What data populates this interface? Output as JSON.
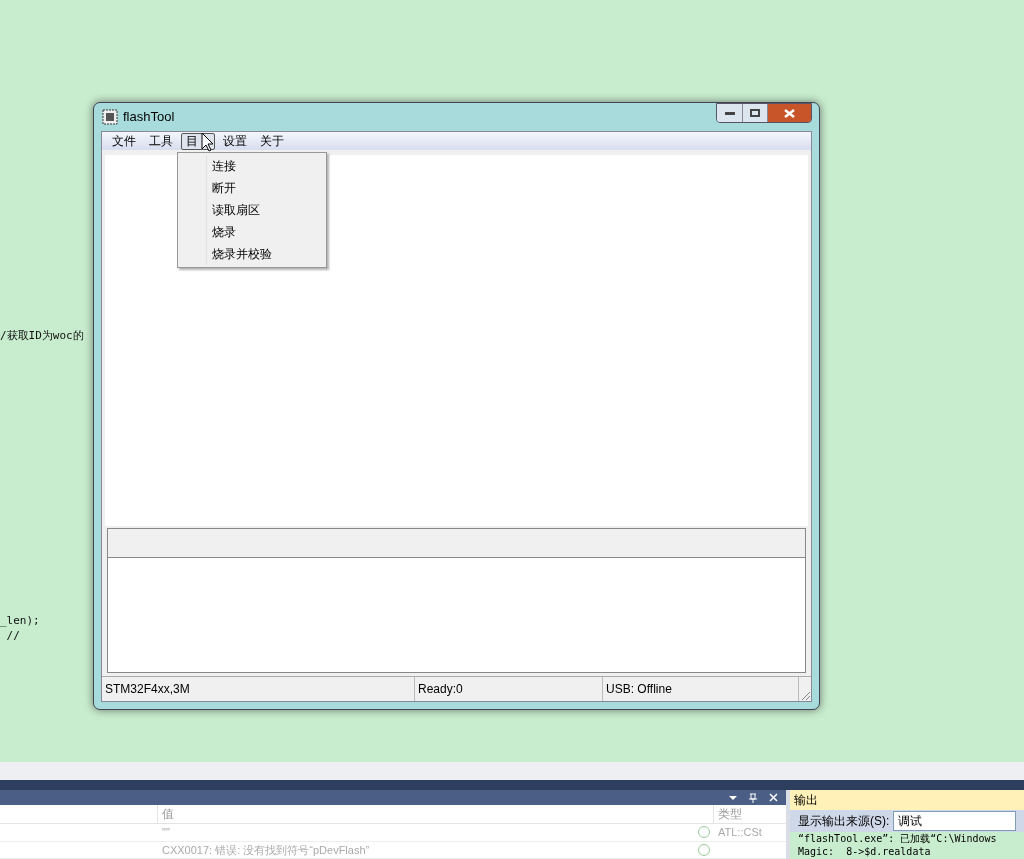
{
  "editor": {
    "code_lines": [
      "/获取ID为woc的",
      "_len);",
      " //"
    ]
  },
  "window": {
    "title": "flashTool",
    "menu": [
      {
        "label": "文件",
        "selected": false
      },
      {
        "label": "工具",
        "selected": false
      },
      {
        "label": "目",
        "selected": true
      },
      {
        "label": "设置",
        "selected": false
      },
      {
        "label": "关于",
        "selected": false
      }
    ],
    "dropdown": [
      "连接",
      "断开",
      "读取扇区",
      "烧录",
      "烧录并校验"
    ],
    "status_bar": [
      "STM32F4xx,3M",
      "Ready:0",
      "USB: Offline"
    ]
  },
  "watch_panel": {
    "columns": [
      "值",
      "类型"
    ],
    "rows": [
      [
        "\"\"",
        "ATL::CSt"
      ],
      [
        "CXX0017: 错误: 没有找到符号“pDevFlash”",
        ""
      ]
    ]
  },
  "output_panel": {
    "title": "输出",
    "source_label": "显示输出来源(S):",
    "source_value": "调试",
    "lines": [
      "“flashTool.exe”: 已加载“C:\\Windows",
      "Magic:  8->$d.realdata"
    ]
  }
}
